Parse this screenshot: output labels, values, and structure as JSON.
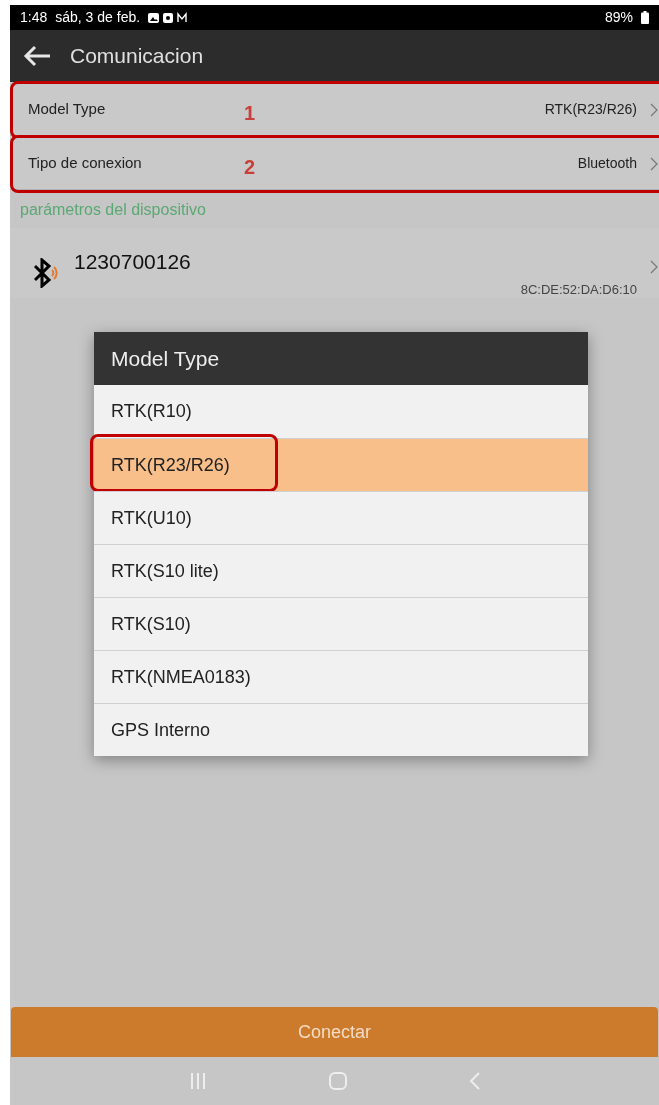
{
  "status_bar": {
    "time": "1:48",
    "date": "sáb, 3 de feb.",
    "battery": "89%"
  },
  "app_bar": {
    "title": "Comunicacion"
  },
  "settings": [
    {
      "label": "Model Type",
      "value": "RTK(R23/R26)",
      "annotation": "1"
    },
    {
      "label": "Tipo de conexion",
      "value": "Bluetooth",
      "annotation": "2"
    }
  ],
  "section_title": "parámetros del dispositivo",
  "device": {
    "name": "1230700126",
    "address": "8C:DE:52:DA:D6:10"
  },
  "dialog": {
    "title": "Model Type",
    "options": [
      {
        "label": "RTK(R10)",
        "selected": false
      },
      {
        "label": "RTK(R23/R26)",
        "selected": true
      },
      {
        "label": "RTK(U10)",
        "selected": false
      },
      {
        "label": "RTK(S10 lite)",
        "selected": false
      },
      {
        "label": "RTK(S10)",
        "selected": false
      },
      {
        "label": "RTK(NMEA0183)",
        "selected": false
      },
      {
        "label": "GPS Interno",
        "selected": false
      }
    ]
  },
  "connect_button": "Conectar"
}
